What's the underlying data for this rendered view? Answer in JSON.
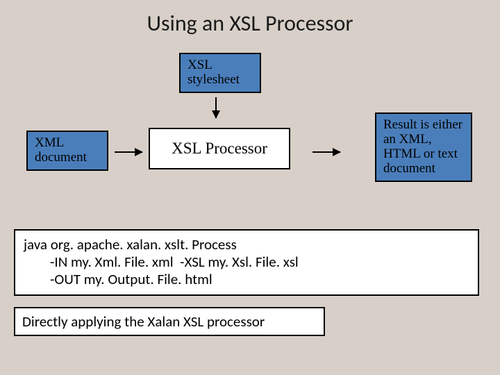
{
  "title": "Using an XSL Processor",
  "nodes": {
    "stylesheet": "XSL\nstylesheet",
    "xmldoc": "XML\ndocument",
    "processor": "XSL Processor",
    "result": "Result is either an XML, HTML or text document"
  },
  "code": "java org. apache. xalan. xslt. Process\n        -IN my. Xml. File. xml  -XSL my. Xsl. File. xsl\n        -OUT my. Output. File. html",
  "caption": "Directly applying the Xalan XSL processor"
}
